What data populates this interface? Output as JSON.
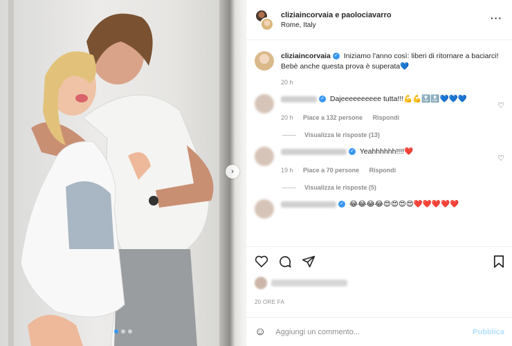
{
  "post": {
    "header_names": "cliziaincorvaia e paolociavarro",
    "location": "Rome, Italy"
  },
  "caption": {
    "username": "cliziaincorvaia",
    "text": "Iniziamo l'anno così: liberi di ritornare a baciarci! Bebè anche questa prova è superata💙",
    "time": "20 h"
  },
  "comments": [
    {
      "text": "Dajeeeeeeeeee tutta!!!💪💪🔝🔝💙💙💙",
      "time": "20 h",
      "likes": "Piace a 132 persone",
      "reply": "Rispondi",
      "view_replies": "Visualizza le risposte (13)"
    },
    {
      "text": "Yeahhhhhh!!!!❤️",
      "time": "19 h",
      "likes": "Piace a 70 persone",
      "reply": "Rispondi",
      "view_replies": "Visualizza le risposte (5)"
    },
    {
      "text": "😂😂😂😂😍😍😍😍❤️❤️❤️❤️❤️"
    }
  ],
  "time_ago": "20 ORE FA",
  "add_comment": {
    "placeholder": "Aggiungi un commento...",
    "publish": "Pubblica"
  },
  "colors": {
    "accent": "#3897f0",
    "publish_disabled": "#b2dffc"
  }
}
